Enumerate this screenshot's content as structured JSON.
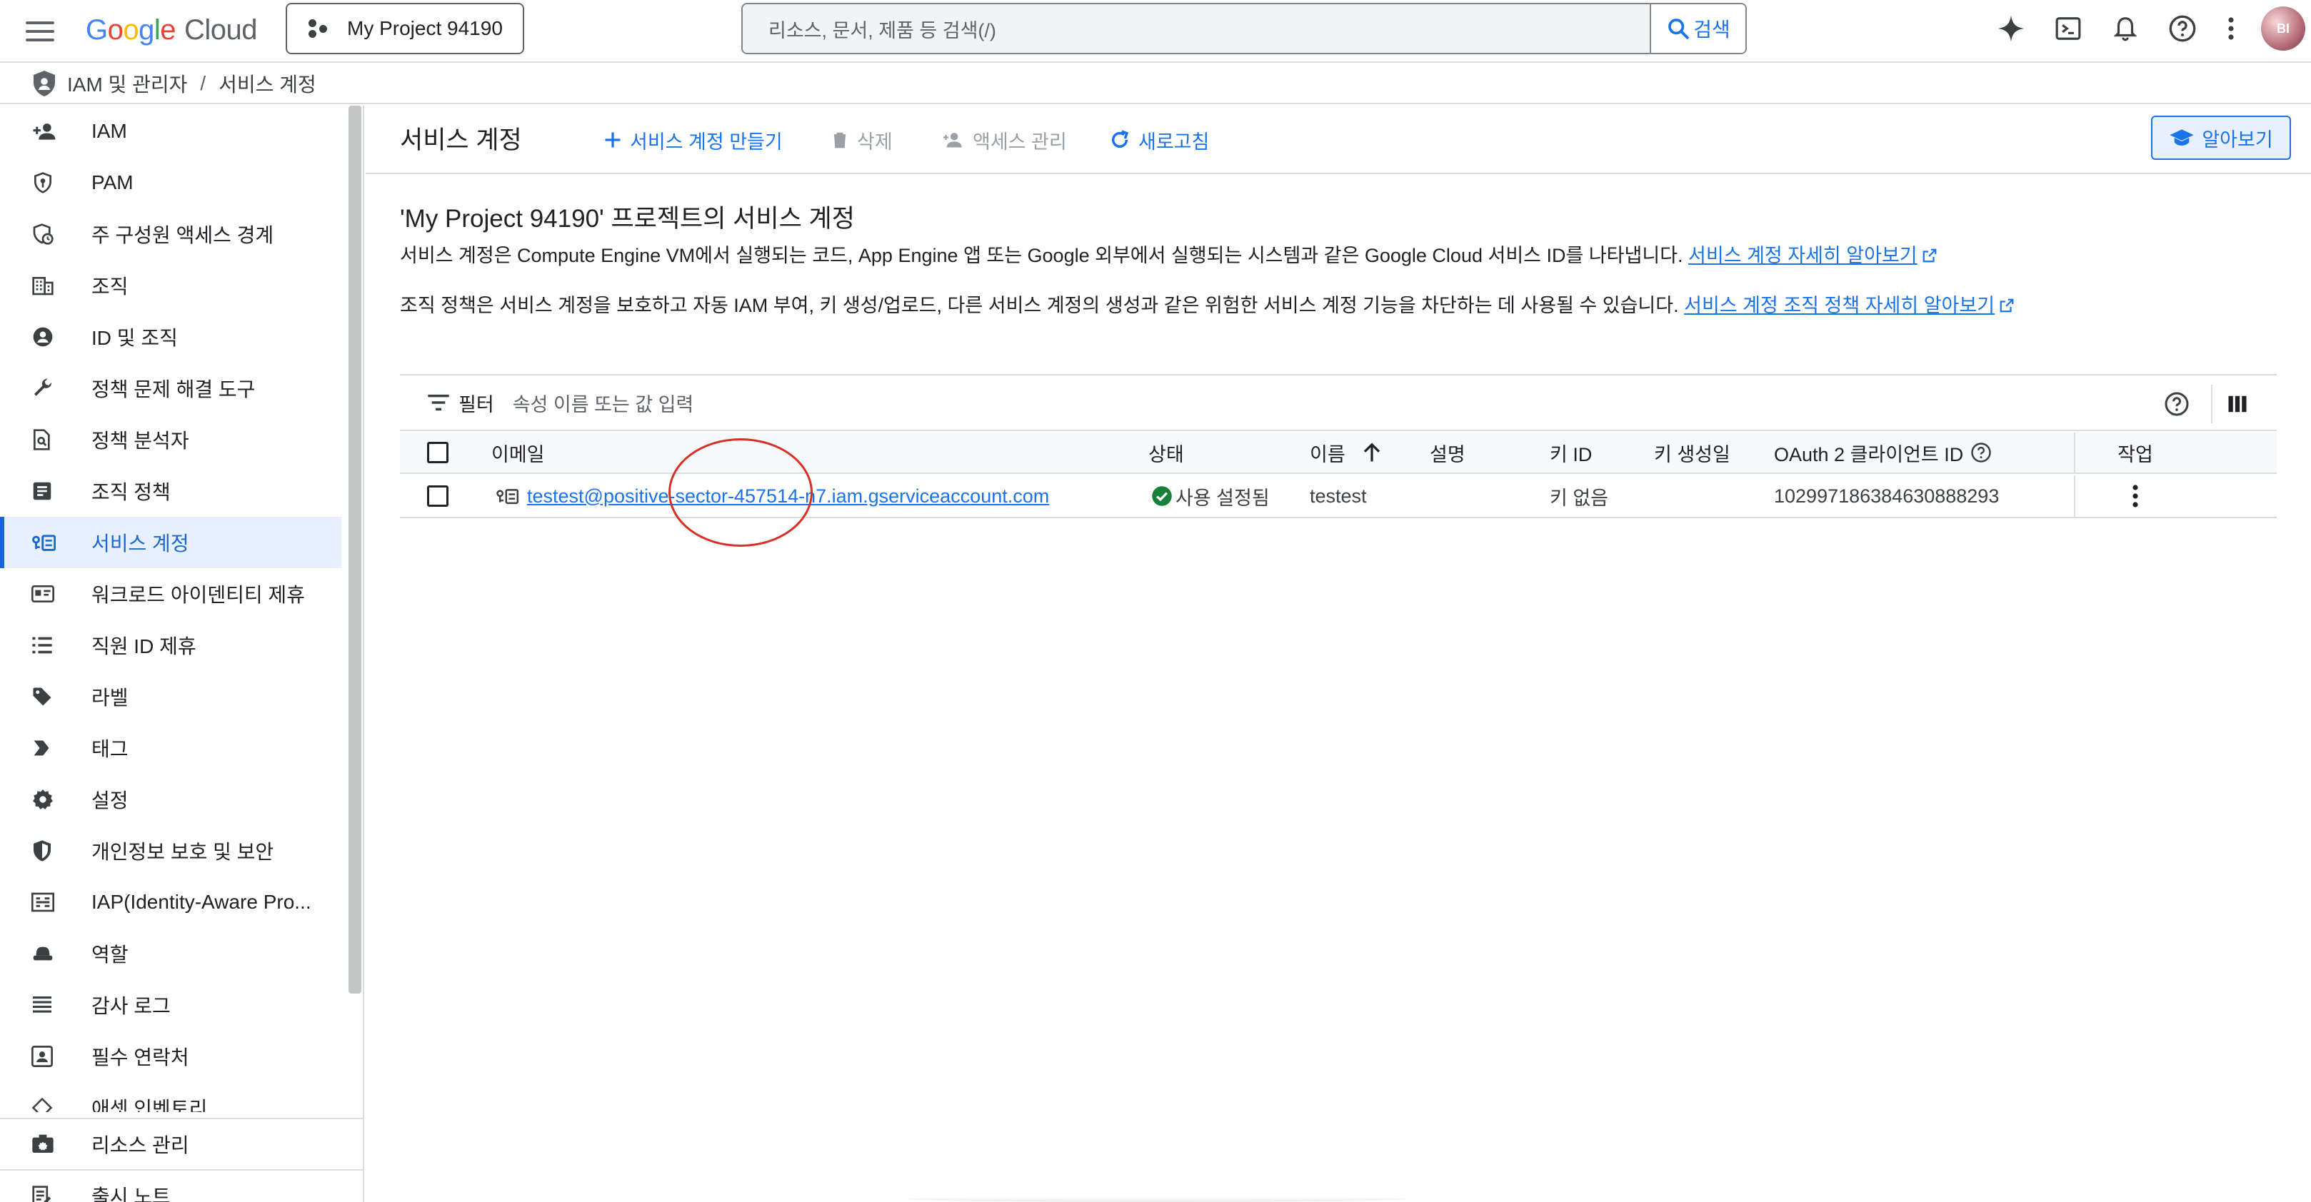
{
  "topbar": {
    "logo_google": "Google",
    "logo_cloud": "Cloud",
    "project_name": "My Project 94190",
    "search_placeholder": "리소스, 문서, 제품 등 검색(/)",
    "search_button": "검색",
    "avatar_initials": "BI"
  },
  "breadcrumb": {
    "section": "IAM 및 관리자",
    "separator": "/",
    "current": "서비스 계정"
  },
  "sidebar": {
    "items": [
      {
        "label": "IAM",
        "icon": "person-add-icon"
      },
      {
        "label": "PAM",
        "icon": "shield-key-icon"
      },
      {
        "label": "주 구성원 액세스 경계",
        "icon": "shield-clock-icon"
      },
      {
        "label": "조직",
        "icon": "building-icon"
      },
      {
        "label": "ID 및 조직",
        "icon": "account-circle-icon"
      },
      {
        "label": "정책 문제 해결 도구",
        "icon": "wrench-icon"
      },
      {
        "label": "정책 분석자",
        "icon": "doc-search-icon"
      },
      {
        "label": "조직 정책",
        "icon": "list-doc-icon"
      },
      {
        "label": "서비스 계정",
        "icon": "service-account-icon",
        "active": true
      },
      {
        "label": "워크로드 아이덴티티 제휴",
        "icon": "id-card-icon"
      },
      {
        "label": "직원 ID 제휴",
        "icon": "list-icon"
      },
      {
        "label": "라벨",
        "icon": "tag-icon"
      },
      {
        "label": "태그",
        "icon": "chevron-tag-icon"
      },
      {
        "label": "설정",
        "icon": "gear-icon"
      },
      {
        "label": "개인정보 보호 및 보안",
        "icon": "privacy-shield-icon"
      },
      {
        "label": "IAP(Identity-Aware Pro...",
        "icon": "iap-icon"
      },
      {
        "label": "역할",
        "icon": "hat-icon"
      },
      {
        "label": "감사 로그",
        "icon": "lines-icon"
      },
      {
        "label": "필수 연락처",
        "icon": "contact-icon"
      },
      {
        "label": "애셋 인벤토리",
        "icon": "diamond-icon"
      }
    ],
    "bottom_items": [
      {
        "label": "리소스 관리",
        "icon": "resource-icon"
      },
      {
        "label": "출시 노트",
        "icon": "notes-icon"
      }
    ]
  },
  "main": {
    "title": "서비스 계정",
    "actions": {
      "create": "서비스 계정 만들기",
      "delete": "삭제",
      "manage_access": "액세스 관리",
      "refresh": "새로고침"
    },
    "learn_button": "알아보기",
    "heading": "'My Project 94190' 프로젝트의 서비스 계정",
    "para1_text": "서비스 계정은 Compute Engine VM에서 실행되는 코드, App Engine 앱 또는 Google 외부에서 실행되는 시스템과 같은 Google Cloud 서비스 ID를 나타냅니다. ",
    "para1_link": "서비스 계정 자세히 알아보기",
    "para2_text": "조직 정책은 서비스 계정을 보호하고 자동 IAM 부여, 키 생성/업로드, 다른 서비스 계정의 생성과 같은 위험한 서비스 계정 기능을 차단하는 데 사용될 수 있습니다. ",
    "para2_link": "서비스 계정 조직 정책 자세히 알아보기"
  },
  "table": {
    "filter_label": "필터",
    "filter_placeholder": "속성 이름 또는 값 입력",
    "columns": {
      "email": "이메일",
      "status": "상태",
      "name": "이름",
      "description": "설명",
      "key_id": "키 ID",
      "key_created": "키 생성일",
      "oauth": "OAuth 2 클라이언트 ID",
      "actions": "작업"
    },
    "rows": [
      {
        "email": "testest@positive-sector-457514-n7.iam.gserviceaccount.com",
        "status": "사용 설정됨",
        "name": "testest",
        "description": "",
        "key_id": "키 없음",
        "key_created": "",
        "oauth": "102997186384630888293"
      }
    ]
  },
  "colors": {
    "accent": "#1a73e8",
    "active_bg": "#e8f0fe",
    "success": "#188038",
    "annotation": "#d93025"
  }
}
